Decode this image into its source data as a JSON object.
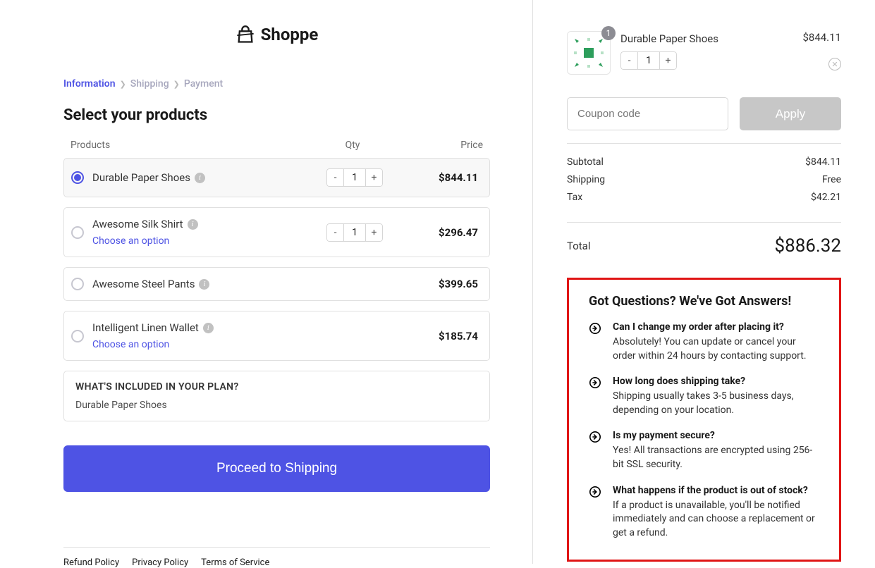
{
  "logo": {
    "text": "Shoppe"
  },
  "breadcrumb": {
    "step1": "Information",
    "step2": "Shipping",
    "step3": "Payment"
  },
  "section_title": "Select your products",
  "table": {
    "col_products": "Products",
    "col_qty": "Qty",
    "col_price": "Price"
  },
  "products": [
    {
      "name": "Durable Paper Shoes",
      "qty": "1",
      "price": "$844.11",
      "selected": true,
      "choose": ""
    },
    {
      "name": "Awesome Silk Shirt",
      "qty": "1",
      "price": "$296.47",
      "selected": false,
      "choose": "Choose an option"
    },
    {
      "name": "Awesome Steel Pants",
      "qty": "",
      "price": "$399.65",
      "selected": false,
      "choose": ""
    },
    {
      "name": "Intelligent Linen Wallet",
      "qty": "",
      "price": "$185.74",
      "selected": false,
      "choose": "Choose an option"
    }
  ],
  "included": {
    "title": "WHAT'S INCLUDED IN YOUR PLAN?",
    "body": "Durable Paper Shoes"
  },
  "proceed_label": "Proceed to Shipping",
  "footer": {
    "refund": "Refund Policy",
    "privacy": "Privacy Policy",
    "terms": "Terms of Service"
  },
  "cart": {
    "item_name": "Durable Paper Shoes",
    "item_price": "$844.11",
    "item_qty": "1",
    "badge": "1"
  },
  "coupon": {
    "placeholder": "Coupon code",
    "apply": "Apply"
  },
  "summary": {
    "subtotal_label": "Subtotal",
    "subtotal_val": "$844.11",
    "shipping_label": "Shipping",
    "shipping_val": "Free",
    "tax_label": "Tax",
    "tax_val": "$42.21",
    "total_label": "Total",
    "total_val": "$886.32"
  },
  "faq": {
    "title": "Got Questions? We've Got Answers!",
    "items": [
      {
        "q": "Can I change my order after placing it?",
        "a": "Absolutely! You can update or cancel your order within 24 hours by contacting support."
      },
      {
        "q": "How long does shipping take?",
        "a": "Shipping usually takes 3-5 business days, depending on your location."
      },
      {
        "q": "Is my payment secure?",
        "a": "Yes! All transactions are encrypted using 256-bit SSL security."
      },
      {
        "q": "What happens if the product is out of stock?",
        "a": "If a product is unavailable, you'll be notified immediately and can choose a replacement or get a refund."
      }
    ]
  }
}
